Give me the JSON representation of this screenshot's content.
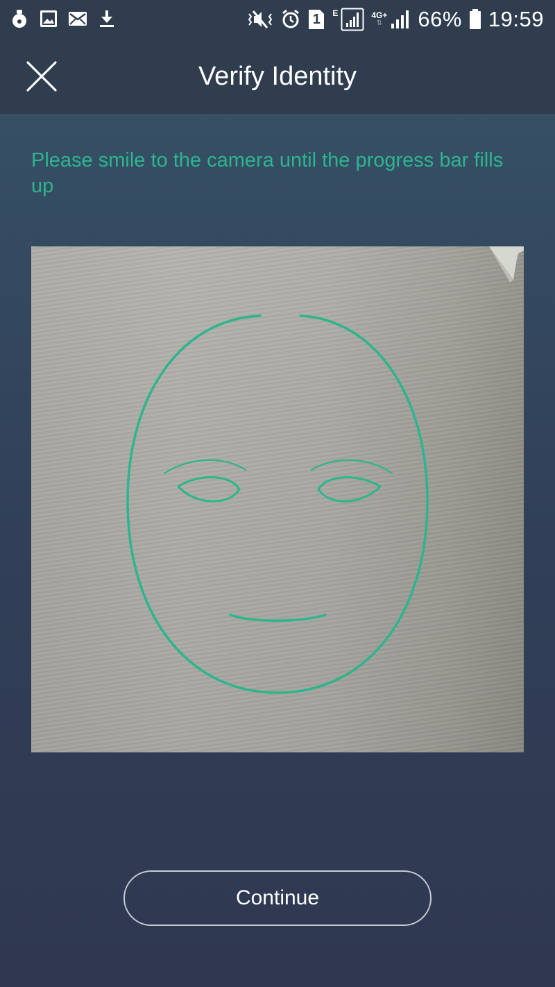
{
  "status_bar": {
    "battery_percent": "66%",
    "time": "19:59",
    "sim_slot": "1",
    "network_e": "E",
    "network_4g": "4G+",
    "icons": [
      "notification-icon",
      "gallery-icon",
      "mail-icon",
      "download-icon",
      "vibrate-mute-icon",
      "alarm-icon",
      "sim-icon",
      "signal-icon",
      "signal-4g-icon",
      "battery-icon"
    ]
  },
  "header": {
    "title": "Verify Identity",
    "close_icon": "close-icon"
  },
  "instruction": {
    "text": "Please smile to the camera until the progress bar fills up"
  },
  "camera": {
    "guide_color": "#2cb58e"
  },
  "actions": {
    "continue_label": "Continue"
  },
  "colors": {
    "accent": "#2cb58e",
    "header_bg": "#2f3d4f"
  }
}
